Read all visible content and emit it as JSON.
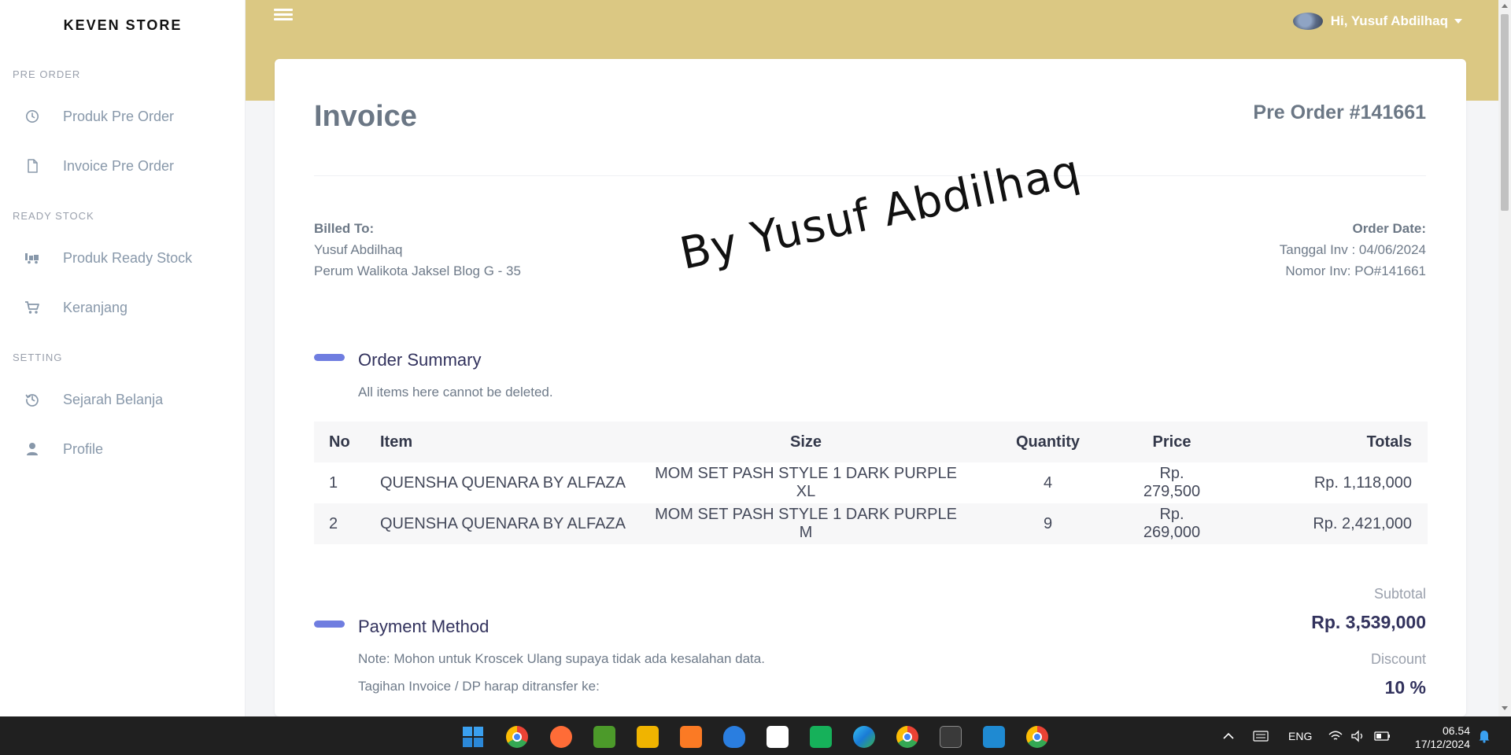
{
  "app": {
    "brand": "KEVEN STORE"
  },
  "sidebar": {
    "sections": [
      {
        "heading": "PRE ORDER",
        "items": [
          {
            "label": "Produk Pre Order",
            "icon": "clock-icon"
          },
          {
            "label": "Invoice Pre Order",
            "icon": "file-icon"
          }
        ]
      },
      {
        "heading": "READY STOCK",
        "items": [
          {
            "label": "Produk Ready Stock",
            "icon": "truck-icon"
          },
          {
            "label": "Keranjang",
            "icon": "cart-icon"
          }
        ]
      },
      {
        "heading": "SETTING",
        "items": [
          {
            "label": "Sejarah Belanja",
            "icon": "history-icon"
          },
          {
            "label": "Profile",
            "icon": "user-icon"
          }
        ]
      }
    ]
  },
  "topbar": {
    "user_greeting": "Hi, Yusuf Abdilhaq"
  },
  "invoice": {
    "title": "Invoice",
    "po_number": "Pre Order #141661",
    "billed_to_label": "Billed To:",
    "billed_name": "Yusuf Abdilhaq",
    "billed_address": "Perum Walikota Jaksel Blog G - 35",
    "order_date_label": "Order Date:",
    "tanggal_inv": "Tanggal Inv : 04/06/2024",
    "nomor_inv": "Nomor Inv: PO#141661",
    "watermark": "By Yusuf Abdilhaq"
  },
  "order_summary": {
    "title": "Order Summary",
    "subtitle": "All items here cannot be deleted.",
    "columns": [
      "No",
      "Item",
      "Size",
      "Quantity",
      "Price",
      "Totals"
    ],
    "rows": [
      {
        "no": "1",
        "item": "QUENSHA QUENARA BY ALFAZA",
        "size": "MOM SET PASH STYLE 1 DARK PURPLE XL",
        "quantity": "4",
        "price": "Rp. 279,500",
        "total": "Rp. 1,118,000"
      },
      {
        "no": "2",
        "item": "QUENSHA QUENARA BY ALFAZA",
        "size": "MOM SET PASH STYLE 1 DARK PURPLE M",
        "quantity": "9",
        "price": "Rp. 269,000",
        "total": "Rp. 2,421,000"
      }
    ]
  },
  "payment": {
    "title": "Payment Method",
    "note": "Note: Mohon untuk Kroscek Ulang supaya tidak ada kesalahan data.",
    "transfer": "Tagihan Invoice / DP harap ditransfer ke:"
  },
  "summary": {
    "subtotal_label": "Subtotal",
    "subtotal_value": "Rp. 3,539,000",
    "discount_label": "Discount",
    "discount_value": "10 %"
  },
  "taskbar": {
    "apps": [
      "windows-start-icon",
      "chrome-icon",
      "postman-icon",
      "monitor-app-icon",
      "file-explorer-icon",
      "xampp-icon",
      "pgadmin-icon",
      "capcut-icon",
      "sheets-icon",
      "edge-icon",
      "chrome-profile-icon",
      "terminal-icon",
      "vscode-icon",
      "chrome-alt-icon"
    ],
    "language": "ENG",
    "time": "06.54",
    "date": "17/12/2024"
  },
  "colors": {
    "topbar": "#dbc883",
    "accent": "#6f7de0",
    "sidebar_text": "#8898aa"
  }
}
